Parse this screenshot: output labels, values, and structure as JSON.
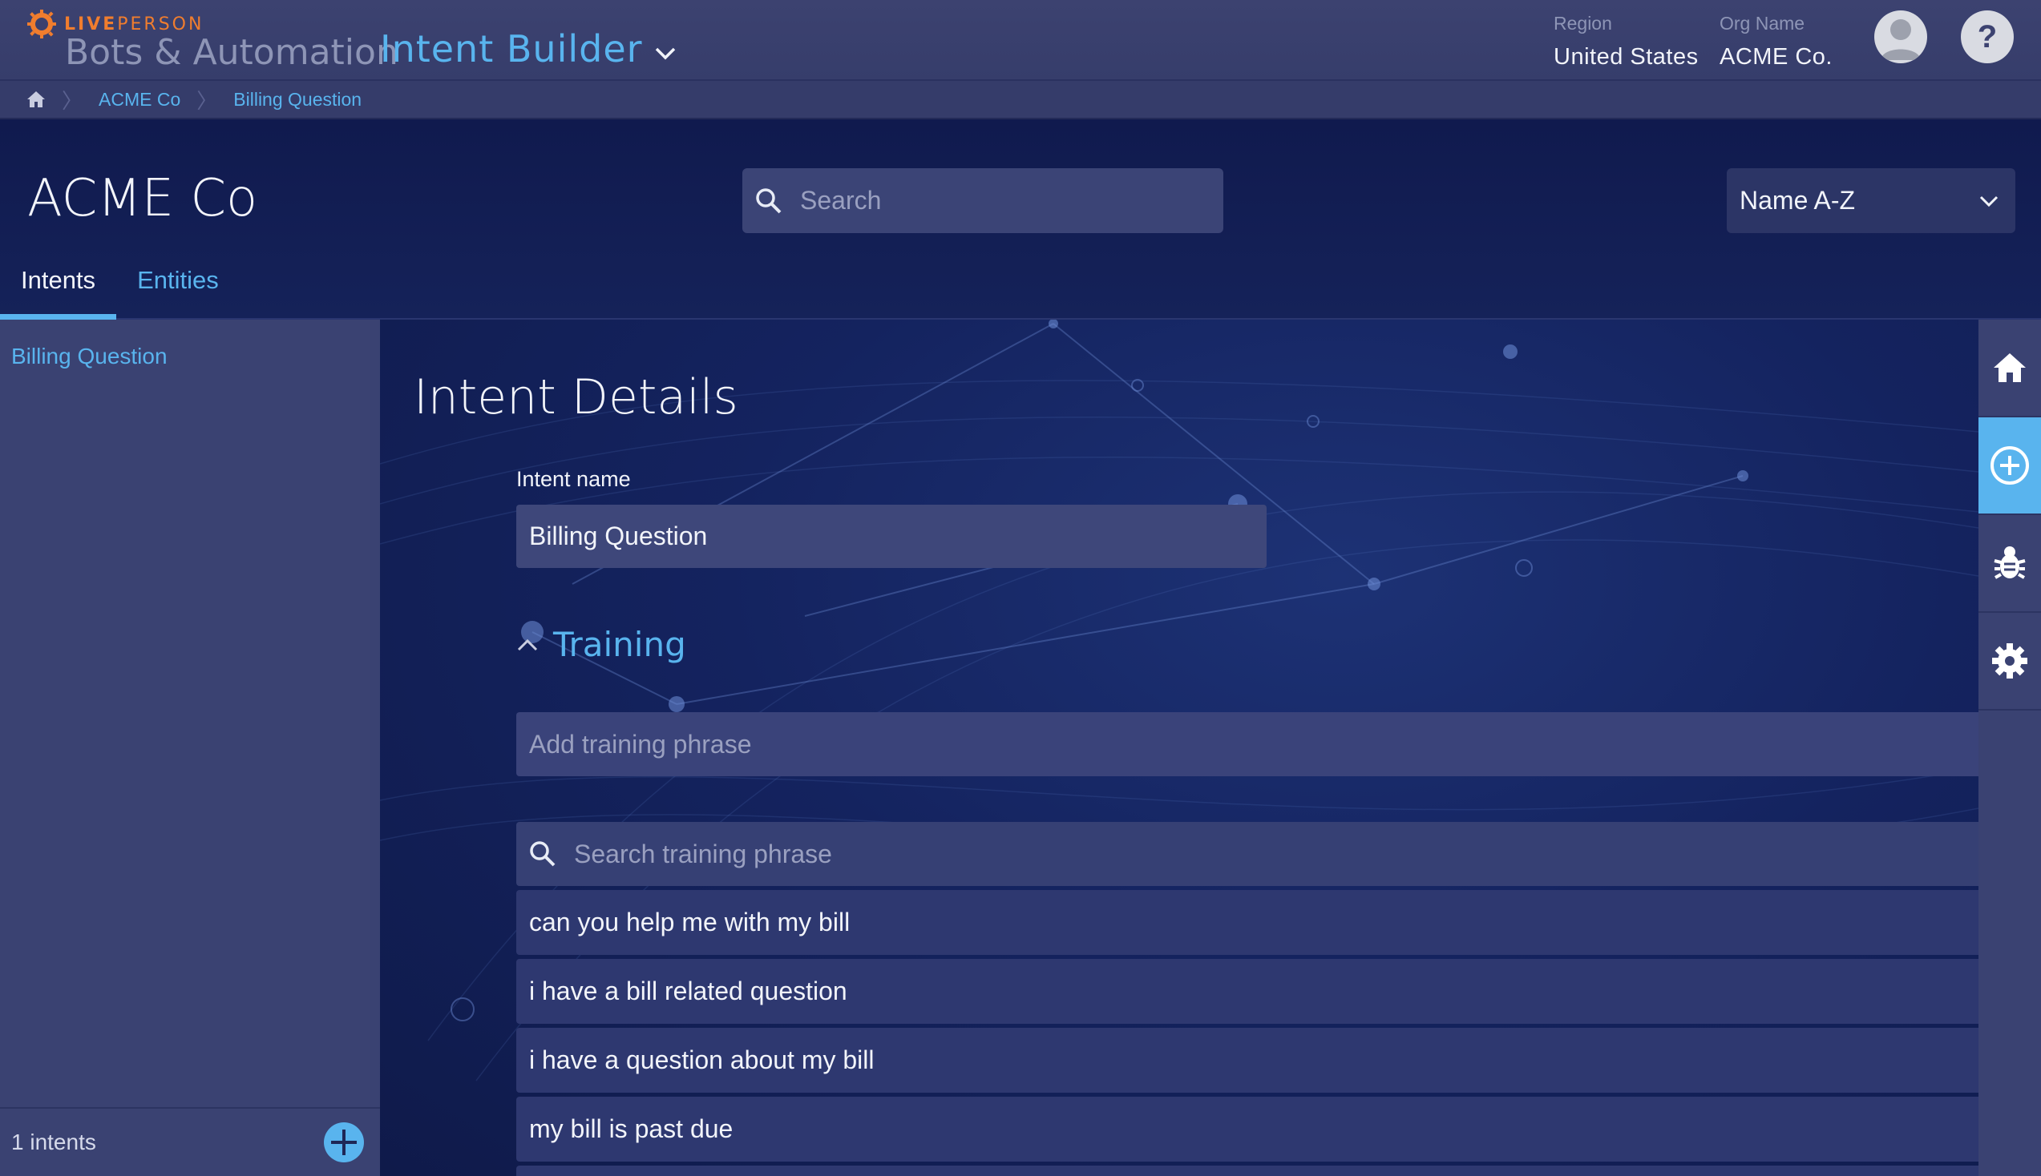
{
  "brand": {
    "logo_text_bold": "LIVE",
    "logo_text_thin": "PERSON",
    "product": "Bots & Automation",
    "app_name": "Intent Builder"
  },
  "header": {
    "region_label": "Region",
    "region_value": "United States",
    "org_label": "Org Name",
    "org_value": "ACME Co.",
    "help_label": "?"
  },
  "breadcrumb": {
    "items": [
      "ACME Co",
      "Billing Question"
    ]
  },
  "hero": {
    "title": "ACME Co",
    "search_placeholder": "Search",
    "sort_value": "Name A-Z",
    "tabs": [
      "Intents",
      "Entities"
    ]
  },
  "sidebar": {
    "intents": [
      "Billing Question"
    ],
    "count_text": "1 intents"
  },
  "main": {
    "section_title": "Intent Details",
    "intent_name_label": "Intent name",
    "intent_name_value": "Billing Question",
    "training_label": "Training",
    "add_phrase_placeholder": "Add training phrase",
    "search_phrase_placeholder": "Search training phrase",
    "phrases": [
      "can you help me with my bill",
      "i have a bill related question",
      "i have a question about my bill",
      "my bill is past due"
    ]
  },
  "colors": {
    "accent": "#59b4ee",
    "brand_orange": "#f07d2e",
    "topbar": "#3c4270",
    "hero_bg": "#101a4e"
  },
  "rail": {
    "icons": [
      "home-icon",
      "add-icon",
      "bug-icon",
      "gear-icon"
    ],
    "active": "add-icon"
  }
}
